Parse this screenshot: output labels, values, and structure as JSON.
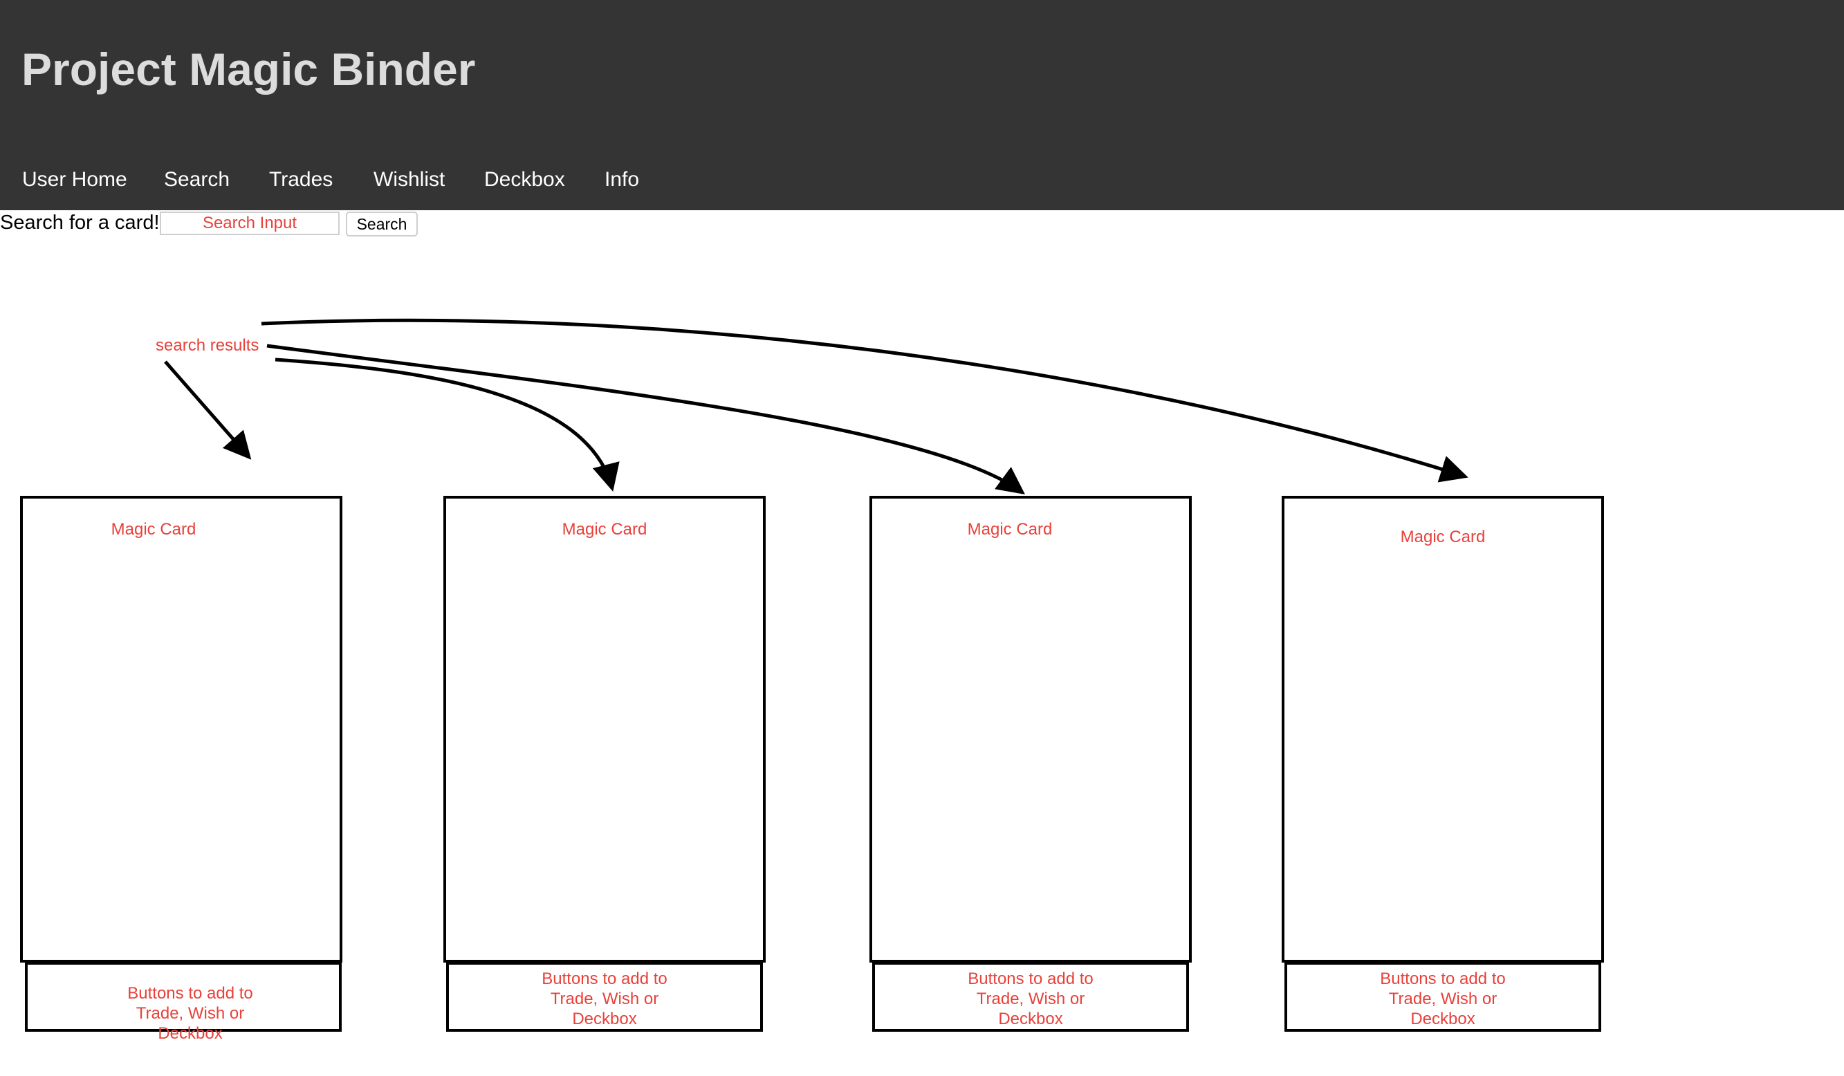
{
  "header": {
    "title": "Project Magic Binder",
    "nav": [
      {
        "label": "User Home"
      },
      {
        "label": "Search"
      },
      {
        "label": "Trades"
      },
      {
        "label": "Wishlist"
      },
      {
        "label": "Deckbox"
      },
      {
        "label": "Info"
      }
    ]
  },
  "search": {
    "prompt": "Search for a card!",
    "placeholder": "Search Input",
    "button_label": "Search"
  },
  "annotations": {
    "search_results": "search results"
  },
  "cards": [
    {
      "label": "Magic Card",
      "buttons_note": "Buttons to add to\nTrade, Wish or\nDeckbox"
    },
    {
      "label": "Magic Card",
      "buttons_note": "Buttons to add to\nTrade, Wish or\nDeckbox"
    },
    {
      "label": "Magic Card",
      "buttons_note": "Buttons to add to\nTrade, Wish or\nDeckbox"
    },
    {
      "label": "Magic Card",
      "buttons_note": "Buttons to add to\nTrade, Wish or\nDeckbox"
    }
  ],
  "colors": {
    "header_bg": "#343434",
    "title_text": "#dcdcdc",
    "nav_text": "#ffffff",
    "annotation_red": "#e8413a",
    "outline": "#000000"
  }
}
